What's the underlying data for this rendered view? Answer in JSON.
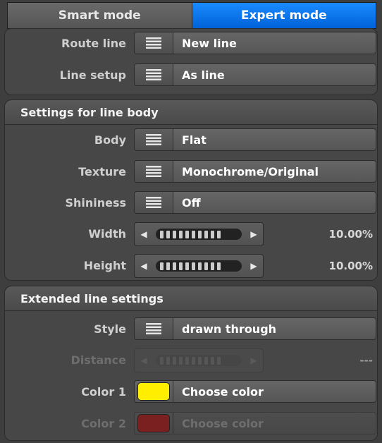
{
  "tabs": {
    "smart": "Smart mode",
    "expert": "Expert mode"
  },
  "top": {
    "route_line": {
      "label": "Route line",
      "value": "New line"
    },
    "line_setup": {
      "label": "Line setup",
      "value": "As line"
    }
  },
  "body_section": {
    "title": "Settings for line body",
    "body": {
      "label": "Body",
      "value": "Flat"
    },
    "texture": {
      "label": "Texture",
      "value": "Monochrome/Original"
    },
    "shininess": {
      "label": "Shininess",
      "value": "Off"
    },
    "width": {
      "label": "Width",
      "value": "10.00%"
    },
    "height": {
      "label": "Height",
      "value": "10.00%"
    }
  },
  "extended": {
    "title": "Extended line settings",
    "style": {
      "label": "Style",
      "value": "drawn through"
    },
    "distance": {
      "label": "Distance",
      "value": "---"
    },
    "color1": {
      "label": "Color 1",
      "value": "Choose color",
      "swatch": "#ffee00"
    },
    "color2": {
      "label": "Color 2",
      "value": "Choose color",
      "swatch": "#7a2020"
    }
  },
  "colors": {
    "accent": "#1a7cf0",
    "panel": "#474747",
    "background": "#3e3e3e"
  },
  "icons": {
    "menu": "menu-lines-icon",
    "left": "arrow-left-icon",
    "right": "arrow-right-icon"
  }
}
